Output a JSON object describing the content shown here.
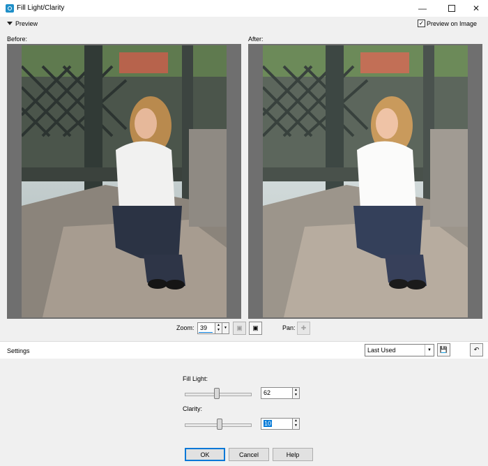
{
  "window": {
    "title": "Fill Light/Clarity",
    "minimize_icon": "minimize-icon",
    "maximize_icon": "maximize-icon",
    "close_icon": "close-icon"
  },
  "preview": {
    "toggle_label": "Preview",
    "preview_on_image_label": "Preview on Image",
    "preview_on_image_checked": true,
    "before_label": "Before:",
    "after_label": "After:"
  },
  "zoom": {
    "label": "Zoom:",
    "value": "39",
    "pan_label": "Pan:"
  },
  "settings": {
    "label": "Settings",
    "preset_value": "Last Used"
  },
  "fill_light": {
    "label": "Fill Light:",
    "value": "62",
    "slider_fraction": 0.49
  },
  "clarity": {
    "label": "Clarity:",
    "value": "10",
    "slider_fraction": 0.53
  },
  "buttons": {
    "ok": "OK",
    "cancel": "Cancel",
    "help": "Help"
  },
  "colors": {
    "accent": "#0078d7",
    "frame": "#6f6f6f"
  }
}
